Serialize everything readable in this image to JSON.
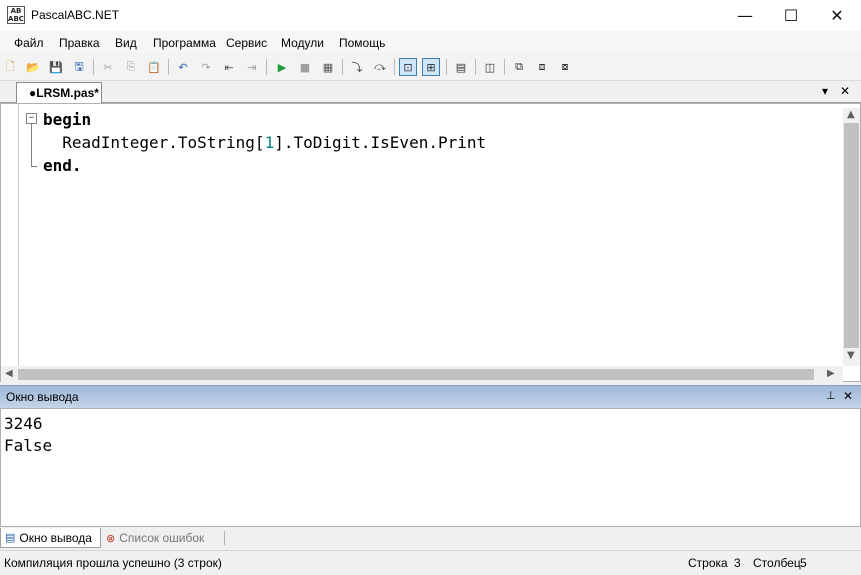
{
  "window": {
    "title": "PascalABC.NET",
    "icon_text": "AB ABC.NET"
  },
  "window_controls": {
    "minimize": "—",
    "maximize": "☐",
    "close": "✕"
  },
  "menu": [
    "Файл",
    "Правка",
    "Вид",
    "Программа",
    "Сервис",
    "Модули",
    "Помощь"
  ],
  "toolbar": [
    {
      "name": "new-file-icon",
      "glyph": "🗋"
    },
    {
      "name": "open-file-icon",
      "glyph": "📂"
    },
    {
      "name": "save-icon",
      "glyph": "💾"
    },
    {
      "name": "save-all-icon",
      "glyph": "🖫"
    },
    {
      "name": "cut-icon",
      "glyph": "✂"
    },
    {
      "name": "copy-icon",
      "glyph": "⎘"
    },
    {
      "name": "paste-icon",
      "glyph": "📋"
    },
    {
      "name": "undo-icon",
      "glyph": "↶"
    },
    {
      "name": "redo-icon",
      "glyph": "↷"
    },
    {
      "name": "navigate-back-icon",
      "glyph": "⇤"
    },
    {
      "name": "navigate-forward-icon",
      "glyph": "⇥"
    },
    {
      "name": "run-icon",
      "glyph": "▶"
    },
    {
      "name": "stop-icon",
      "glyph": "■"
    },
    {
      "name": "compile-icon",
      "glyph": "▦"
    },
    {
      "name": "step-into-icon",
      "glyph": "⤵"
    },
    {
      "name": "step-over-icon",
      "glyph": "⤼"
    },
    {
      "name": "output-window-icon",
      "glyph": "⊡"
    },
    {
      "name": "editor-window-icon",
      "glyph": "⊞"
    },
    {
      "name": "format-code-icon",
      "glyph": "▤"
    },
    {
      "name": "designer-icon",
      "glyph": "◫"
    },
    {
      "name": "debug-watch-icon",
      "glyph": "⧉"
    },
    {
      "name": "debug-local-icon",
      "glyph": "⧈"
    },
    {
      "name": "debug-result-icon",
      "glyph": "⧇"
    }
  ],
  "editor_tab": {
    "label": "●LRSM.pas*",
    "dropdown": "▾",
    "close": "✕"
  },
  "code": {
    "lines": [
      {
        "kind": "kw",
        "text": "begin"
      },
      {
        "kind": "mixed",
        "parts": [
          "  ReadInteger.ToString[",
          "1",
          "].ToDigit.IsEven.Print"
        ]
      },
      {
        "kind": "kw",
        "text": "end."
      }
    ],
    "fold_glyph": "−"
  },
  "scroll": {
    "up": "▲",
    "down": "▼",
    "left": "◀",
    "right": "▶"
  },
  "output_panel": {
    "title": "Окно вывода",
    "pin": "📌",
    "close": "✕",
    "lines": [
      "3246",
      "False"
    ]
  },
  "bottom_tabs": [
    {
      "label": "Окно вывода",
      "icon": "▤",
      "active": true
    },
    {
      "label": "Список ошибок",
      "icon": "⊗",
      "active": false
    }
  ],
  "status": {
    "message": "Компиляция прошла успешно (3 строк)",
    "row_label": "Строка",
    "row_value": "3",
    "col_label": "Столбец",
    "col_value": "5"
  }
}
